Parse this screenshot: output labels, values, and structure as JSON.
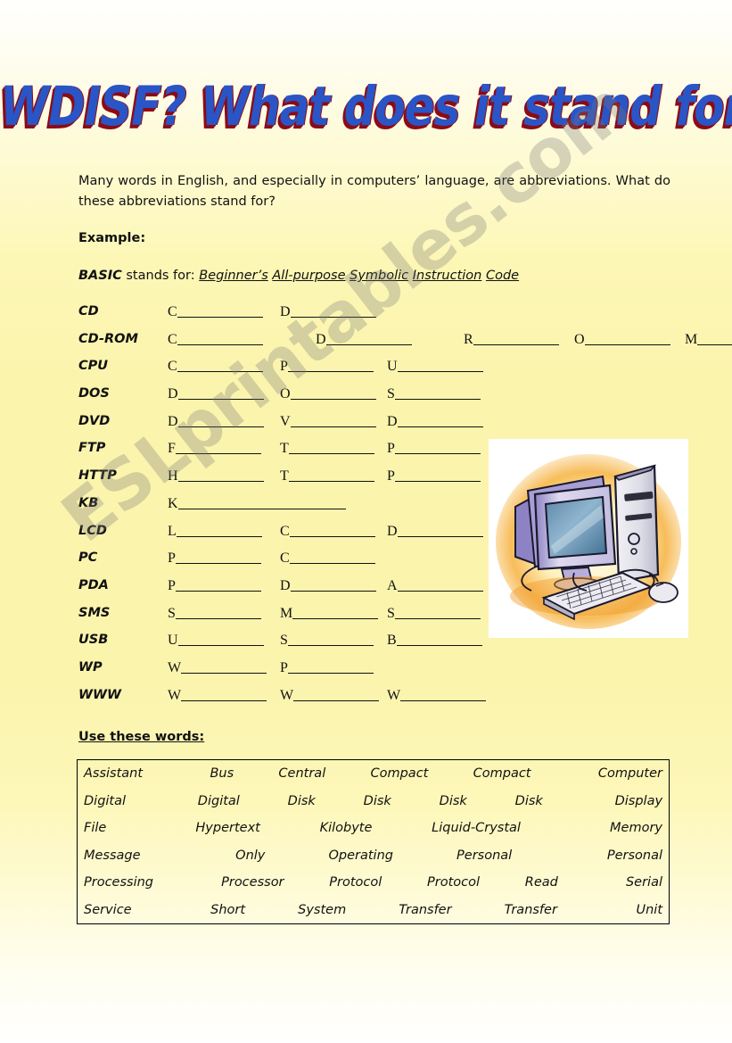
{
  "title": "WDISF? What does it stand for?",
  "intro": "Many words in English, and especially in computers’ language, are abbreviations. What do these abbreviations stand for?",
  "example_label": "Example:",
  "example": {
    "abbr": "BASIC",
    "connector": " stands for: ",
    "answers": [
      "Beginner’s",
      "All-purpose",
      "Symbolic",
      "Instruction",
      "Code"
    ]
  },
  "abbreviations": [
    {
      "name": "CD",
      "blanks": [
        "C",
        "D"
      ]
    },
    {
      "name": "CD-ROM",
      "blanks": [
        "C",
        "D",
        "R",
        "O",
        "M"
      ]
    },
    {
      "name": "CPU",
      "blanks": [
        "C",
        "P",
        "U"
      ]
    },
    {
      "name": "DOS",
      "blanks": [
        "D",
        "O",
        "S"
      ]
    },
    {
      "name": "DVD",
      "blanks": [
        "D",
        "V",
        "D"
      ]
    },
    {
      "name": "FTP",
      "blanks": [
        "F",
        "T",
        "P"
      ]
    },
    {
      "name": "HTTP",
      "blanks": [
        "H",
        "T",
        "P"
      ]
    },
    {
      "name": "KB",
      "blanks": [
        "K"
      ]
    },
    {
      "name": "LCD",
      "blanks": [
        "L",
        "C",
        "D"
      ]
    },
    {
      "name": "PC",
      "blanks": [
        "P",
        "C"
      ]
    },
    {
      "name": "PDA",
      "blanks": [
        "P",
        "D",
        "A"
      ]
    },
    {
      "name": "SMS",
      "blanks": [
        "S",
        "M",
        "S"
      ]
    },
    {
      "name": "USB",
      "blanks": [
        "U",
        "S",
        "B"
      ]
    },
    {
      "name": "WP",
      "blanks": [
        "W",
        "P"
      ]
    },
    {
      "name": "WWW",
      "blanks": [
        "W",
        "W",
        "W"
      ]
    }
  ],
  "wordbank": {
    "label": "Use these words:",
    "rows": [
      [
        "Assistant",
        "Bus",
        "Central",
        "Compact",
        "Compact",
        "Computer"
      ],
      [
        "Digital",
        "Digital",
        "Disk",
        "Disk",
        "Disk",
        "Disk",
        "Display"
      ],
      [
        "File",
        "Hypertext",
        "Kilobyte",
        "Liquid-Crystal",
        "Memory"
      ],
      [
        "Message",
        "Only",
        "Operating",
        "Personal",
        "Personal"
      ],
      [
        "Processing",
        "Processor",
        "Protocol",
        "Protocol",
        "Read",
        "Serial"
      ],
      [
        "Service",
        "Short",
        "System",
        "Transfer",
        "Transfer",
        "Unit"
      ]
    ]
  },
  "watermark": "ESLprintables.com",
  "clipart": {
    "name": "desktop-computer-clipart",
    "description": "Illustration of a desktop computer with CRT monitor, tower, keyboard and mouse"
  },
  "colors": {
    "title_fill": "#2a55c6",
    "title_shadow": "#8c0b16",
    "page_yellow": "#fbf4ad",
    "text": "#111111",
    "border": "#000000"
  }
}
